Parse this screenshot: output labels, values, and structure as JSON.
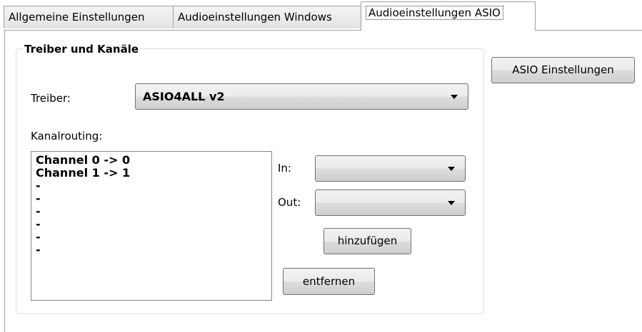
{
  "tabs": [
    {
      "label": "Allgemeine Einstellungen"
    },
    {
      "label": "Audioeinstellungen Windows"
    },
    {
      "label": "Audioeinstellungen ASIO"
    }
  ],
  "group": {
    "title": "Treiber und Kanäle"
  },
  "asio_settings_button": "ASIO Einstellungen",
  "driver": {
    "label": "Treiber:",
    "value": "ASIO4ALL v2"
  },
  "routing": {
    "label": "Kanalrouting:",
    "items": [
      "Channel 0 -> 0",
      "Channel 1 -> 1",
      "-",
      "-",
      "-",
      "-",
      "-",
      "-"
    ]
  },
  "in": {
    "label": "In:",
    "value": ""
  },
  "out": {
    "label": "Out:",
    "value": ""
  },
  "add_button": "hinzufügen",
  "remove_button": "entfernen"
}
